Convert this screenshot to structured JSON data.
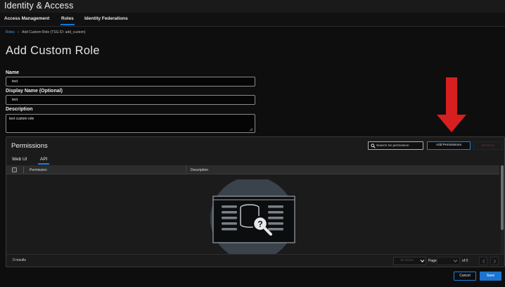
{
  "app": {
    "title": "Identity & Access"
  },
  "nav": {
    "tabs": [
      {
        "label": "Access Management"
      },
      {
        "label": "Roles"
      },
      {
        "label": "Identity Federations"
      }
    ]
  },
  "breadcrumb": {
    "root": "Roles",
    "current": "Add Custom Role (TSG ID: add_custom)"
  },
  "page": {
    "title": "Add Custom Role"
  },
  "form": {
    "name": {
      "label": "Name",
      "value": "test"
    },
    "display_name": {
      "label": "Display Name (Optional)",
      "value": "test"
    },
    "description": {
      "label": "Description",
      "value": "test custom role"
    }
  },
  "permissions": {
    "title": "Permissions",
    "search_placeholder": "Search for permission",
    "add_label": "Add Permissions",
    "remove_label": "Remove",
    "tabs": [
      {
        "label": "Web UI"
      },
      {
        "label": "API"
      }
    ],
    "active_tab": "API",
    "columns": [
      "Permission",
      "Description"
    ],
    "results_text": "0 results",
    "rows_select": "25 Rows",
    "page_label": "Page",
    "of_text": "of 0"
  },
  "actions": {
    "cancel_label": "Cancel",
    "save_label": "Save"
  },
  "colors": {
    "accent": "#1f7fd8",
    "annotation_arrow": "#d81f1f",
    "background": "#0e0e0f"
  },
  "icons": {
    "search": "search-icon",
    "empty_state": "database-magnifier-icon",
    "arrow": "red-down-arrow-icon",
    "dropdown": "chevron-down-icon",
    "prev": "chevron-left-icon",
    "next": "chevron-right-icon"
  }
}
